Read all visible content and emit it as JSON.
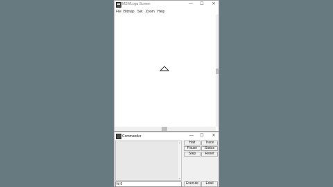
{
  "main_window": {
    "title": "MSWLogo Screen",
    "controls": {
      "minimize": "—",
      "maximize": "☐",
      "close": "✕"
    },
    "menu": [
      "File",
      "Bitmap",
      "Set",
      "Zoom",
      "Help"
    ]
  },
  "commander": {
    "title": "Commander",
    "controls": {
      "minimize": "—",
      "maximize": "☐",
      "close": "✕"
    },
    "buttons": {
      "halt": "Halt",
      "trace": "Trace",
      "pause": "Pause",
      "status": "Status",
      "step": "Step",
      "reset": "Reset",
      "execute": "Execute",
      "edall": "Edall"
    },
    "input_value": "fd 0"
  }
}
